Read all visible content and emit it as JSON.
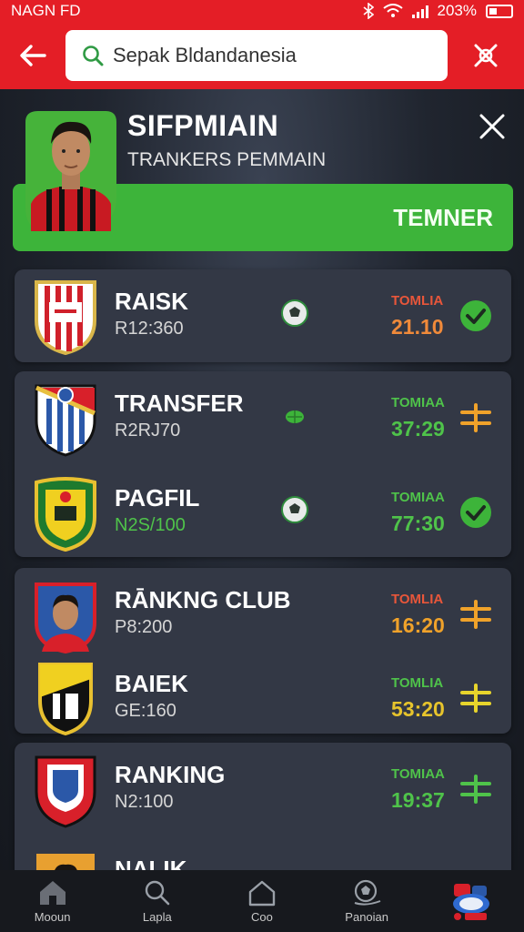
{
  "status_bar": {
    "carrier": "NAGN FD",
    "battery": "203%"
  },
  "header": {
    "search_value": "Sepak Bldandanesia"
  },
  "profile": {
    "name": "SIFPMIAIN",
    "subtitle": "TRANKERS PEMMAIN",
    "banner_label": "TEMNER"
  },
  "list": [
    {
      "title": "RAISK",
      "code": "R12:360",
      "mini_label": "TOMLIA",
      "time": "21.10",
      "label_color": "#e8563a",
      "time_color": "#f08a3a",
      "status": "check",
      "ball": "ball"
    },
    {
      "title": "TRANSFER",
      "code": "R2RJ70",
      "mini_label": "TOMIAA",
      "time": "37:29",
      "label_color": "#4fc34a",
      "time_color": "#4fc34a",
      "status": "swap-orange",
      "ball": "pitch"
    },
    {
      "title": "PAGFIL",
      "code": "N2S/100",
      "mini_label": "TOMIAA",
      "time": "77:30",
      "label_color": "#4fc34a",
      "time_color": "#4fc34a",
      "status": "check",
      "ball": "ball"
    },
    {
      "title": "RĀNKNG CLUB",
      "code": "P8:200",
      "mini_label": "TOMLIA",
      "time": "16:20",
      "label_color": "#e8563a",
      "time_color": "#f0a22a",
      "status": "swap-orange",
      "ball": ""
    },
    {
      "title": "BAIEK",
      "code": "GE:160",
      "mini_label": "TOMLIA",
      "time": "53:20",
      "label_color": "#4fc34a",
      "time_color": "#e7c42c",
      "status": "swap-yellow",
      "ball": ""
    },
    {
      "title": "RANKING",
      "code": "N2:100",
      "mini_label": "TOMIAA",
      "time": "19:37",
      "label_color": "#4fc34a",
      "time_color": "#4fc34a",
      "status": "swap-green",
      "ball": ""
    },
    {
      "title": "NALIK",
      "code": "",
      "mini_label": "",
      "time": "",
      "label_color": "#4fc34a",
      "time_color": "#4fc34a",
      "status": "",
      "ball": ""
    }
  ],
  "nav": [
    {
      "label": "Mooun",
      "icon": "home-icon"
    },
    {
      "label": "Lapla",
      "icon": "search-icon"
    },
    {
      "label": "Coo",
      "icon": "house-outline-icon"
    },
    {
      "label": "Panoian",
      "icon": "ball-icon"
    },
    {
      "label": "",
      "icon": "profile-badge-icon"
    }
  ],
  "colors": {
    "brand_red": "#e41e26",
    "accent_green": "#3db43a",
    "card_bg": "#333845"
  }
}
